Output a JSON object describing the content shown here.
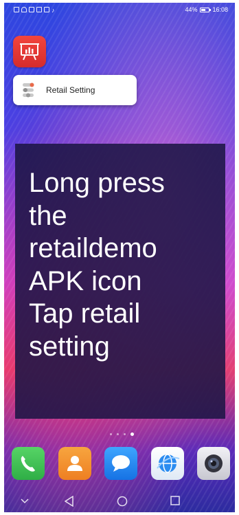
{
  "status_bar": {
    "battery": "44%",
    "battery_level": 0.44,
    "time": "16:08"
  },
  "home": {
    "app_icon": "presentation-chart-icon",
    "popup": {
      "icon": "settings-sliders-icon",
      "label": "Retail Setting"
    },
    "instruction_lines": [
      "Long press",
      "the",
      "retaildemo",
      "APK icon",
      "Tap retail",
      "setting"
    ],
    "page_indicator": {
      "pages": 4,
      "current": 4
    }
  },
  "dock": [
    {
      "name": "phone-icon",
      "color": "#3fbf55"
    },
    {
      "name": "contacts-icon",
      "color": "#f0922f"
    },
    {
      "name": "messages-icon",
      "color": "#1e8ef5"
    },
    {
      "name": "browser-icon",
      "color": "#2b8cf0"
    },
    {
      "name": "camera-icon",
      "color": "#e8e8ee"
    }
  ],
  "nav": [
    "hide-keyboard-icon",
    "back-icon",
    "home-icon",
    "recents-icon"
  ],
  "colors": {
    "overlay": "#1c1646",
    "app_icon": "#e33a35"
  }
}
